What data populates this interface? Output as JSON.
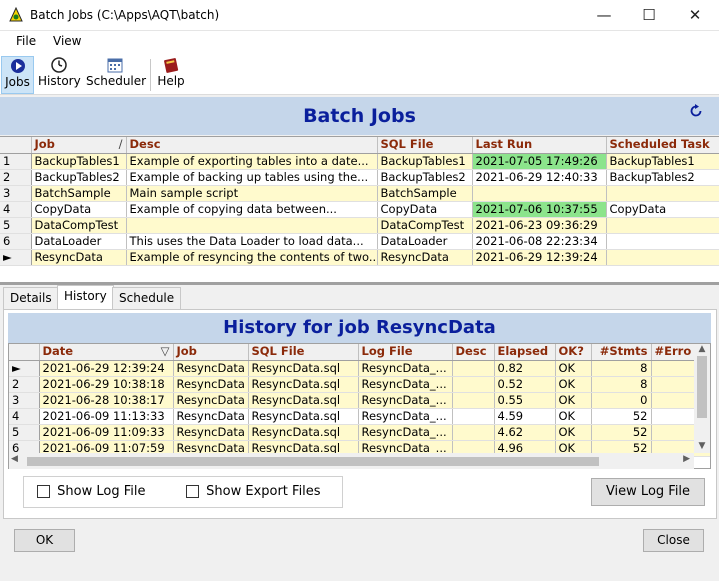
{
  "window": {
    "title": "Batch Jobs (C:\\Apps\\AQT\\batch)",
    "minimize_icon": "minimize-icon",
    "maximize_icon": "maximize-icon",
    "close_icon": "close-icon"
  },
  "menu": {
    "file": "File",
    "view": "View"
  },
  "toolbar": {
    "jobs": "Jobs",
    "history": "History",
    "scheduler": "Scheduler",
    "help": "Help"
  },
  "jobs_panel": {
    "title": "Batch Jobs",
    "refresh_icon": "refresh-icon",
    "columns": [
      "Job",
      "Desc",
      "SQL File",
      "Last Run",
      "Scheduled Task"
    ],
    "sort_indicator": "/",
    "rows": [
      {
        "n": "1",
        "job": "BackupTables1",
        "desc": "Example of exporting tables into a date...",
        "sql": "BackupTables1",
        "last": "2021-07-05 17:49:26",
        "task": "BackupTables1",
        "style": "yel",
        "green": true
      },
      {
        "n": "2",
        "job": "BackupTables2",
        "desc": "Example of backing up tables using the...",
        "sql": "BackupTables2",
        "last": "2021-06-29 12:40:33",
        "task": "BackupTables2",
        "style": "wht",
        "green": false
      },
      {
        "n": "3",
        "job": "BatchSample",
        "desc": "Main sample script",
        "sql": "BatchSample",
        "last": "",
        "task": "",
        "style": "yel",
        "green": false
      },
      {
        "n": "4",
        "job": "CopyData",
        "desc": "Example of copying data between...",
        "sql": "CopyData",
        "last": "2021-07-06 10:37:55",
        "task": "CopyData",
        "style": "wht",
        "green": true
      },
      {
        "n": "5",
        "job": "DataCompTest",
        "desc": "",
        "sql": "DataCompTest",
        "last": "2021-06-23 09:36:29",
        "task": "",
        "style": "yel",
        "green": false
      },
      {
        "n": "6",
        "job": "DataLoader",
        "desc": "This uses the Data Loader to load data...",
        "sql": "DataLoader",
        "last": "2021-06-08 22:23:34",
        "task": "",
        "style": "wht",
        "green": false
      },
      {
        "n": "►",
        "job": "ResyncData",
        "desc": "Example of resyncing the contents of two...",
        "sql": "ResyncData",
        "last": "2021-06-29 12:39:24",
        "task": "",
        "style": "yel",
        "green": false
      }
    ]
  },
  "tabs": {
    "details": "Details",
    "history": "History",
    "schedule": "Schedule"
  },
  "history_panel": {
    "title": "History for job ResyncData",
    "columns": [
      "Date",
      "Job",
      "SQL File",
      "Log File",
      "Desc",
      "Elapsed",
      "OK?",
      "#Stmts",
      "#Erro"
    ],
    "sort_indicator": "▽",
    "rows": [
      {
        "n": "►",
        "date": "2021-06-29 12:39:24",
        "job": "ResyncData",
        "sql": "ResyncData.sql",
        "log": "ResyncData_...",
        "desc": "",
        "elapsed": "0.82",
        "ok": "OK",
        "stmts": "8",
        "style": "yel"
      },
      {
        "n": "2",
        "date": "2021-06-29 10:38:18",
        "job": "ResyncData",
        "sql": "ResyncData.sql",
        "log": "ResyncData_...",
        "desc": "",
        "elapsed": "0.52",
        "ok": "OK",
        "stmts": "8",
        "style": "yel"
      },
      {
        "n": "3",
        "date": "2021-06-28 10:38:17",
        "job": "ResyncData",
        "sql": "ResyncData.sql",
        "log": "ResyncData_...",
        "desc": "",
        "elapsed": "0.55",
        "ok": "OK",
        "stmts": "0",
        "style": "yel"
      },
      {
        "n": "4",
        "date": "2021-06-09 11:13:33",
        "job": "ResyncData",
        "sql": "ResyncData.sql",
        "log": "ResyncData_...",
        "desc": "",
        "elapsed": "4.59",
        "ok": "OK",
        "stmts": "52",
        "style": "wht"
      },
      {
        "n": "5",
        "date": "2021-06-09 11:09:33",
        "job": "ResyncData",
        "sql": "ResyncData.sql",
        "log": "ResyncData_...",
        "desc": "",
        "elapsed": "4.62",
        "ok": "OK",
        "stmts": "52",
        "style": "yel"
      },
      {
        "n": "6",
        "date": "2021-06-09 11:07:59",
        "job": "ResyncData",
        "sql": "ResyncData.sql",
        "log": "ResyncData_...",
        "desc": "",
        "elapsed": "4.96",
        "ok": "OK",
        "stmts": "52",
        "style": "yel"
      }
    ]
  },
  "options": {
    "show_log": "Show Log File",
    "show_export": "Show Export Files",
    "view_log": "View Log File"
  },
  "footer": {
    "ok": "OK",
    "close": "Close"
  }
}
